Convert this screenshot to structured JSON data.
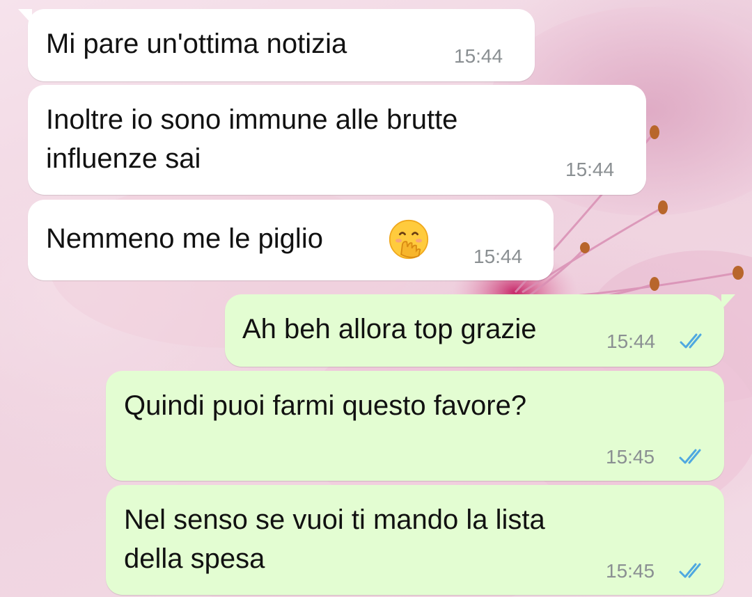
{
  "chat": {
    "messages": [
      {
        "direction": "incoming",
        "text": "Mi pare un'ottima notizia",
        "time": "15:44"
      },
      {
        "direction": "incoming",
        "text": "Inoltre io sono immune alle brutte\ninfluenze sai",
        "time": "15:44"
      },
      {
        "direction": "incoming",
        "text": "Nemmeno me le piglio",
        "emoji": "hand-over-mouth-face-emoji",
        "time": "15:44"
      },
      {
        "direction": "outgoing",
        "text": "Ah beh allora top grazie",
        "time": "15:44",
        "status": "double-check-read"
      },
      {
        "direction": "outgoing",
        "text": "Quindi puoi farmi questo favore?",
        "time": "15:45",
        "status": "double-check-read"
      },
      {
        "direction": "outgoing",
        "text": "Nel senso se vuoi ti mando la lista\ndella spesa",
        "time": "15:45",
        "status": "double-check-read"
      }
    ]
  },
  "colors": {
    "incoming_bubble": "#ffffff",
    "outgoing_bubble": "#e3fdd2",
    "timestamp": "#8a8f92",
    "read_tick": "#4fa8e0",
    "wallpaper": "#f3dbe6"
  }
}
